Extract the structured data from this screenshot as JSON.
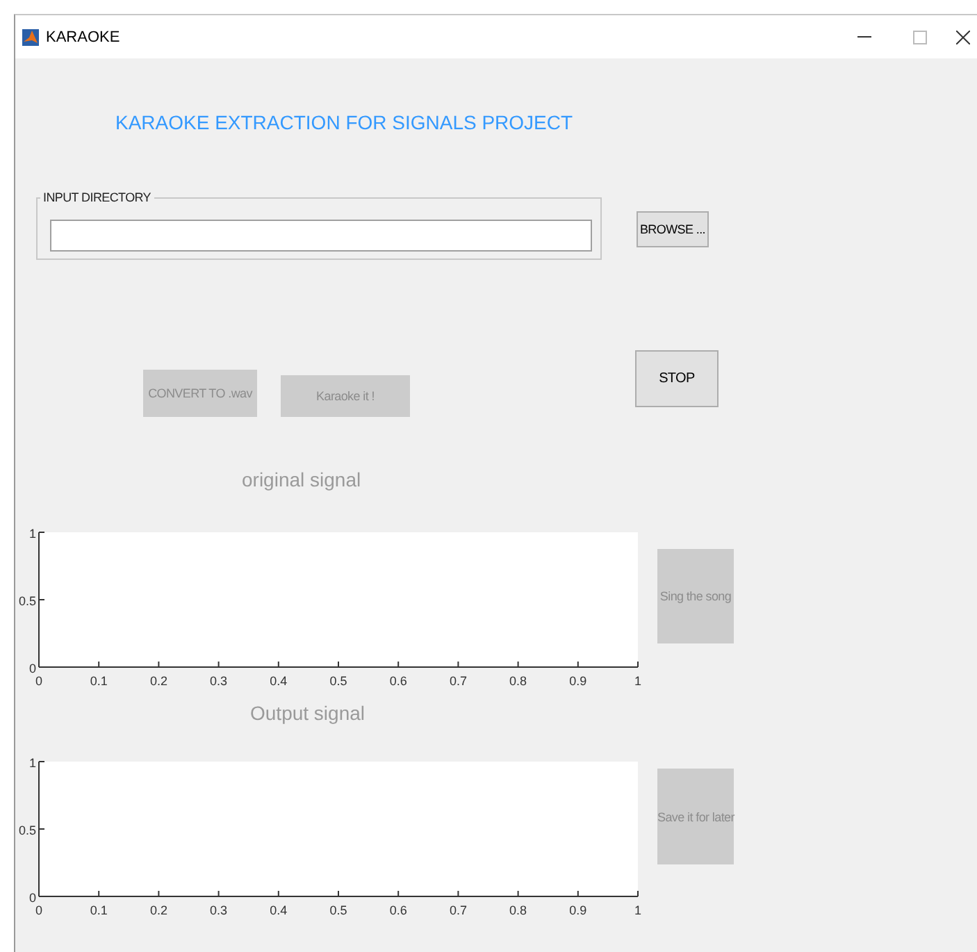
{
  "window": {
    "title": "KARAOKE"
  },
  "heading": "KARAOKE EXTRACTION FOR SIGNALS PROJECT",
  "input_panel": {
    "title": "INPUT DIRECTORY"
  },
  "browse_button": {
    "label": "BROWSE ...",
    "disabled": false
  },
  "convert_button": {
    "label": "CONVERT TO .wav",
    "disabled": true
  },
  "karaoke_button": {
    "label": "Karaoke it !",
    "disabled": true
  },
  "stop_button": {
    "label": "STOP",
    "disabled": false
  },
  "plots": [
    {
      "caption": "original signal",
      "button": {
        "label": "Sing the song",
        "disabled": true
      },
      "chart_data": {
        "type": "line",
        "xlim": [
          0,
          1
        ],
        "ylim": [
          0,
          1
        ],
        "xticks": [
          0,
          0.1,
          0.2,
          0.3,
          0.4,
          0.5,
          0.6,
          0.7,
          0.8,
          0.9,
          1
        ],
        "yticks": [
          0,
          0.5,
          1
        ]
      }
    },
    {
      "caption": "Output signal",
      "button": {
        "label": "Save it for later",
        "disabled": true
      },
      "chart_data": {
        "type": "line",
        "xlim": [
          0,
          1
        ],
        "ylim": [
          0,
          1
        ],
        "xticks": [
          0,
          0.1,
          0.2,
          0.3,
          0.4,
          0.5,
          0.6,
          0.7,
          0.8,
          0.9,
          1
        ],
        "yticks": [
          0,
          0.5,
          1
        ]
      }
    }
  ]
}
